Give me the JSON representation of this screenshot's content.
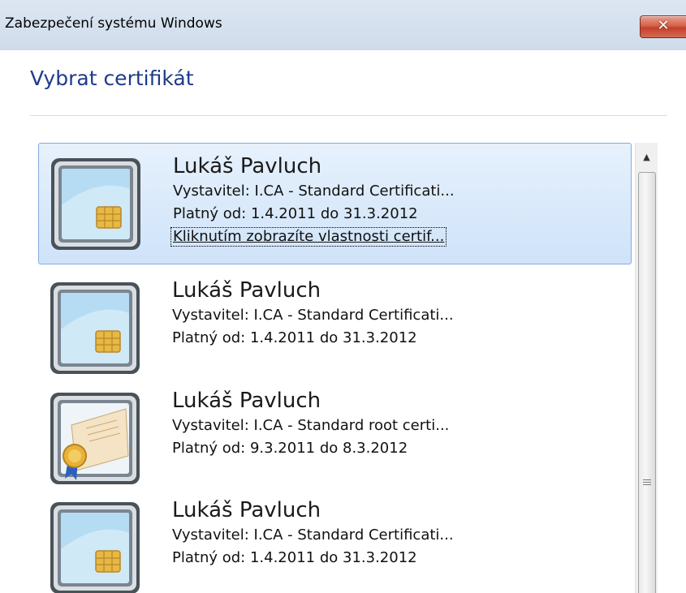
{
  "window": {
    "title": "Zabezpečení systému Windows",
    "close_label": "✕"
  },
  "dialog": {
    "heading": "Vybrat certifikát"
  },
  "certificates": [
    {
      "name": "Lukáš Pavluch",
      "issuer": "Vystavitel: I.CA - Standard Certificati...",
      "validity": "Platný od: 1.4.2011 do 31.3.2012",
      "link": "Kliknutím zobrazíte vlastnosti certif...",
      "icon": "smart-card-icon",
      "selected": true
    },
    {
      "name": "Lukáš Pavluch",
      "issuer": "Vystavitel: I.CA - Standard Certificati...",
      "validity": "Platný od: 1.4.2011 do 31.3.2012",
      "icon": "smart-card-icon",
      "selected": false
    },
    {
      "name": "Lukáš Pavluch",
      "issuer": "Vystavitel: I.CA - Standard root certi...",
      "validity": "Platný od: 9.3.2011 do 8.3.2012",
      "icon": "certificate-icon",
      "selected": false
    },
    {
      "name": "Lukáš Pavluch",
      "issuer": "Vystavitel: I.CA - Standard Certificati...",
      "validity": "Platný od: 1.4.2011 do 31.3.2012",
      "icon": "smart-card-icon",
      "selected": false
    }
  ],
  "colors": {
    "heading": "#1e3a8a",
    "selection": "#cfe3f9",
    "close_button": "#c2412a"
  }
}
